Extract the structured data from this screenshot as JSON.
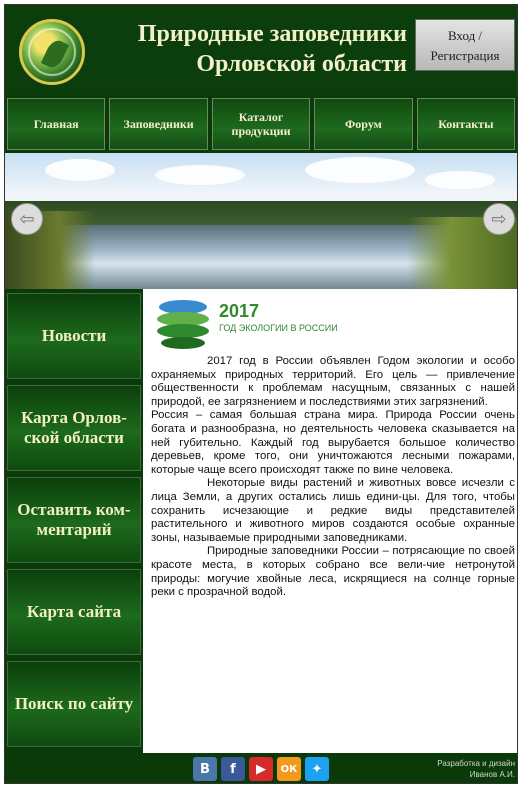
{
  "header": {
    "title_line1": "Природные заповедники",
    "title_line2": "Орловской области",
    "login_line1": "Вход /",
    "login_line2": "Регистрация"
  },
  "nav": {
    "items": [
      "Главная",
      "Заповедники",
      "Каталог продукции",
      "Форум",
      "Контакты"
    ]
  },
  "banner": {
    "prev_icon": "arrow-left-icon",
    "next_icon": "arrow-right-icon",
    "prev_glyph": "⇦",
    "next_glyph": "⇨"
  },
  "sidebar": {
    "items": [
      "Новости",
      "Карта Орлов-ской области",
      "Оставить ком-ментарий",
      "Карта сайта",
      "Поиск по сайту"
    ]
  },
  "content": {
    "eco_year": "2017",
    "eco_subtitle": "ГОД ЭКОЛОГИИ В РОССИИ",
    "paragraphs": [
      "2017 год в России объявлен Годом экологии и особо охраняемых природных территорий. Его цель — привлечение общественности к проблемам насущным, связанных с нашей природой, ее загрязнением и последствиями этих загрязнений.",
      "Россия – самая большая страна мира. Природа России очень богата и разнообразна, но деятельность человека сказывается на ней губительно. Каждый год вырубается большое количество деревьев, кроме того, они уничтожаются лесными пожарами, которые чаще всего происходят также по вине человека.",
      "Некоторые виды растений и животных вовсе исчезли с лица Земли, а других остались лишь едини-цы. Для того, чтобы сохранить исчезающие и редкие виды представителей растительного и животного миров создаются особые охранные зоны, называемые природными заповедниками.",
      "Природные заповедники России – потрясающие по своей красоте места, в которых собрано все вели-чие нетронутой природы: могучие хвойные леса, искрящиеся на солнце горные реки с прозрачной водой."
    ]
  },
  "footer": {
    "social": [
      {
        "label": "B",
        "icon": "vk-icon",
        "color": "#4a76a8"
      },
      {
        "label": "f",
        "icon": "facebook-icon",
        "color": "#3b5998"
      },
      {
        "label": "▶",
        "icon": "youtube-icon",
        "color": "#d62b2b"
      },
      {
        "label": "ОК",
        "icon": "odnoklassniki-icon",
        "color": "#f39a1c"
      },
      {
        "label": "✦",
        "icon": "twitter-icon",
        "color": "#1da1f2"
      }
    ],
    "credit_line1": "Разработка и дизайн",
    "credit_line2": "Иванов А.И."
  },
  "colors": {
    "header_bg": "#0c3d0c",
    "title_text": "#f3f0c8",
    "accent_green": "#2f8a2f"
  }
}
